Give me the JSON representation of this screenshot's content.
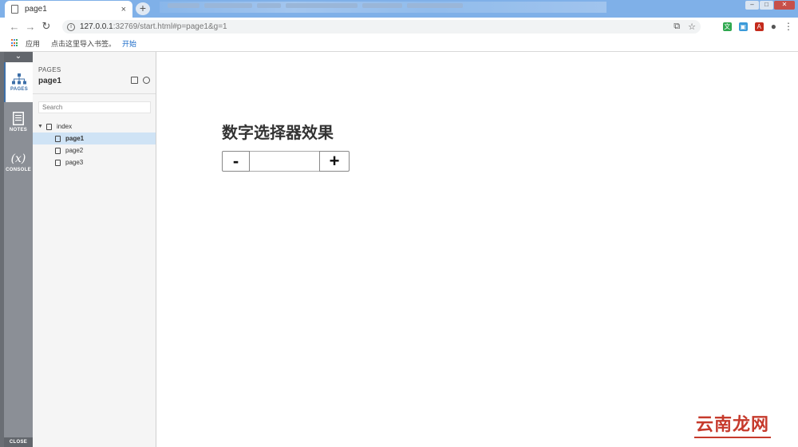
{
  "browser": {
    "tab_title": "page1",
    "tab_close": "×",
    "new_tab": "+",
    "url_host": "127.0.0.1",
    "url_path": ":32769/start.html#p=page1&g=1",
    "bookmarks": {
      "apps_label": "应用",
      "import_text": "点击这里导入书签。",
      "start_link": "开始"
    }
  },
  "sidebar": {
    "toggle": "⌄",
    "items": [
      {
        "label": "PAGES",
        "icon": "sitemap-icon"
      },
      {
        "label": "NOTES",
        "icon": "notes-icon"
      },
      {
        "label": "CONSOLE",
        "icon": "variable-icon",
        "glyph": "(x)"
      }
    ],
    "close_label": "CLOSE"
  },
  "pages_panel": {
    "caption": "PAGES",
    "current_page": "page1",
    "search_placeholder": "Search",
    "tree": {
      "root": "index",
      "children": [
        "page1",
        "page2",
        "page3"
      ],
      "selected": "page1"
    }
  },
  "canvas": {
    "heading": "数字选择器效果",
    "stepper": {
      "minus_label": "-",
      "plus_label": "+",
      "value": ""
    }
  },
  "watermark": "云南龙网"
}
